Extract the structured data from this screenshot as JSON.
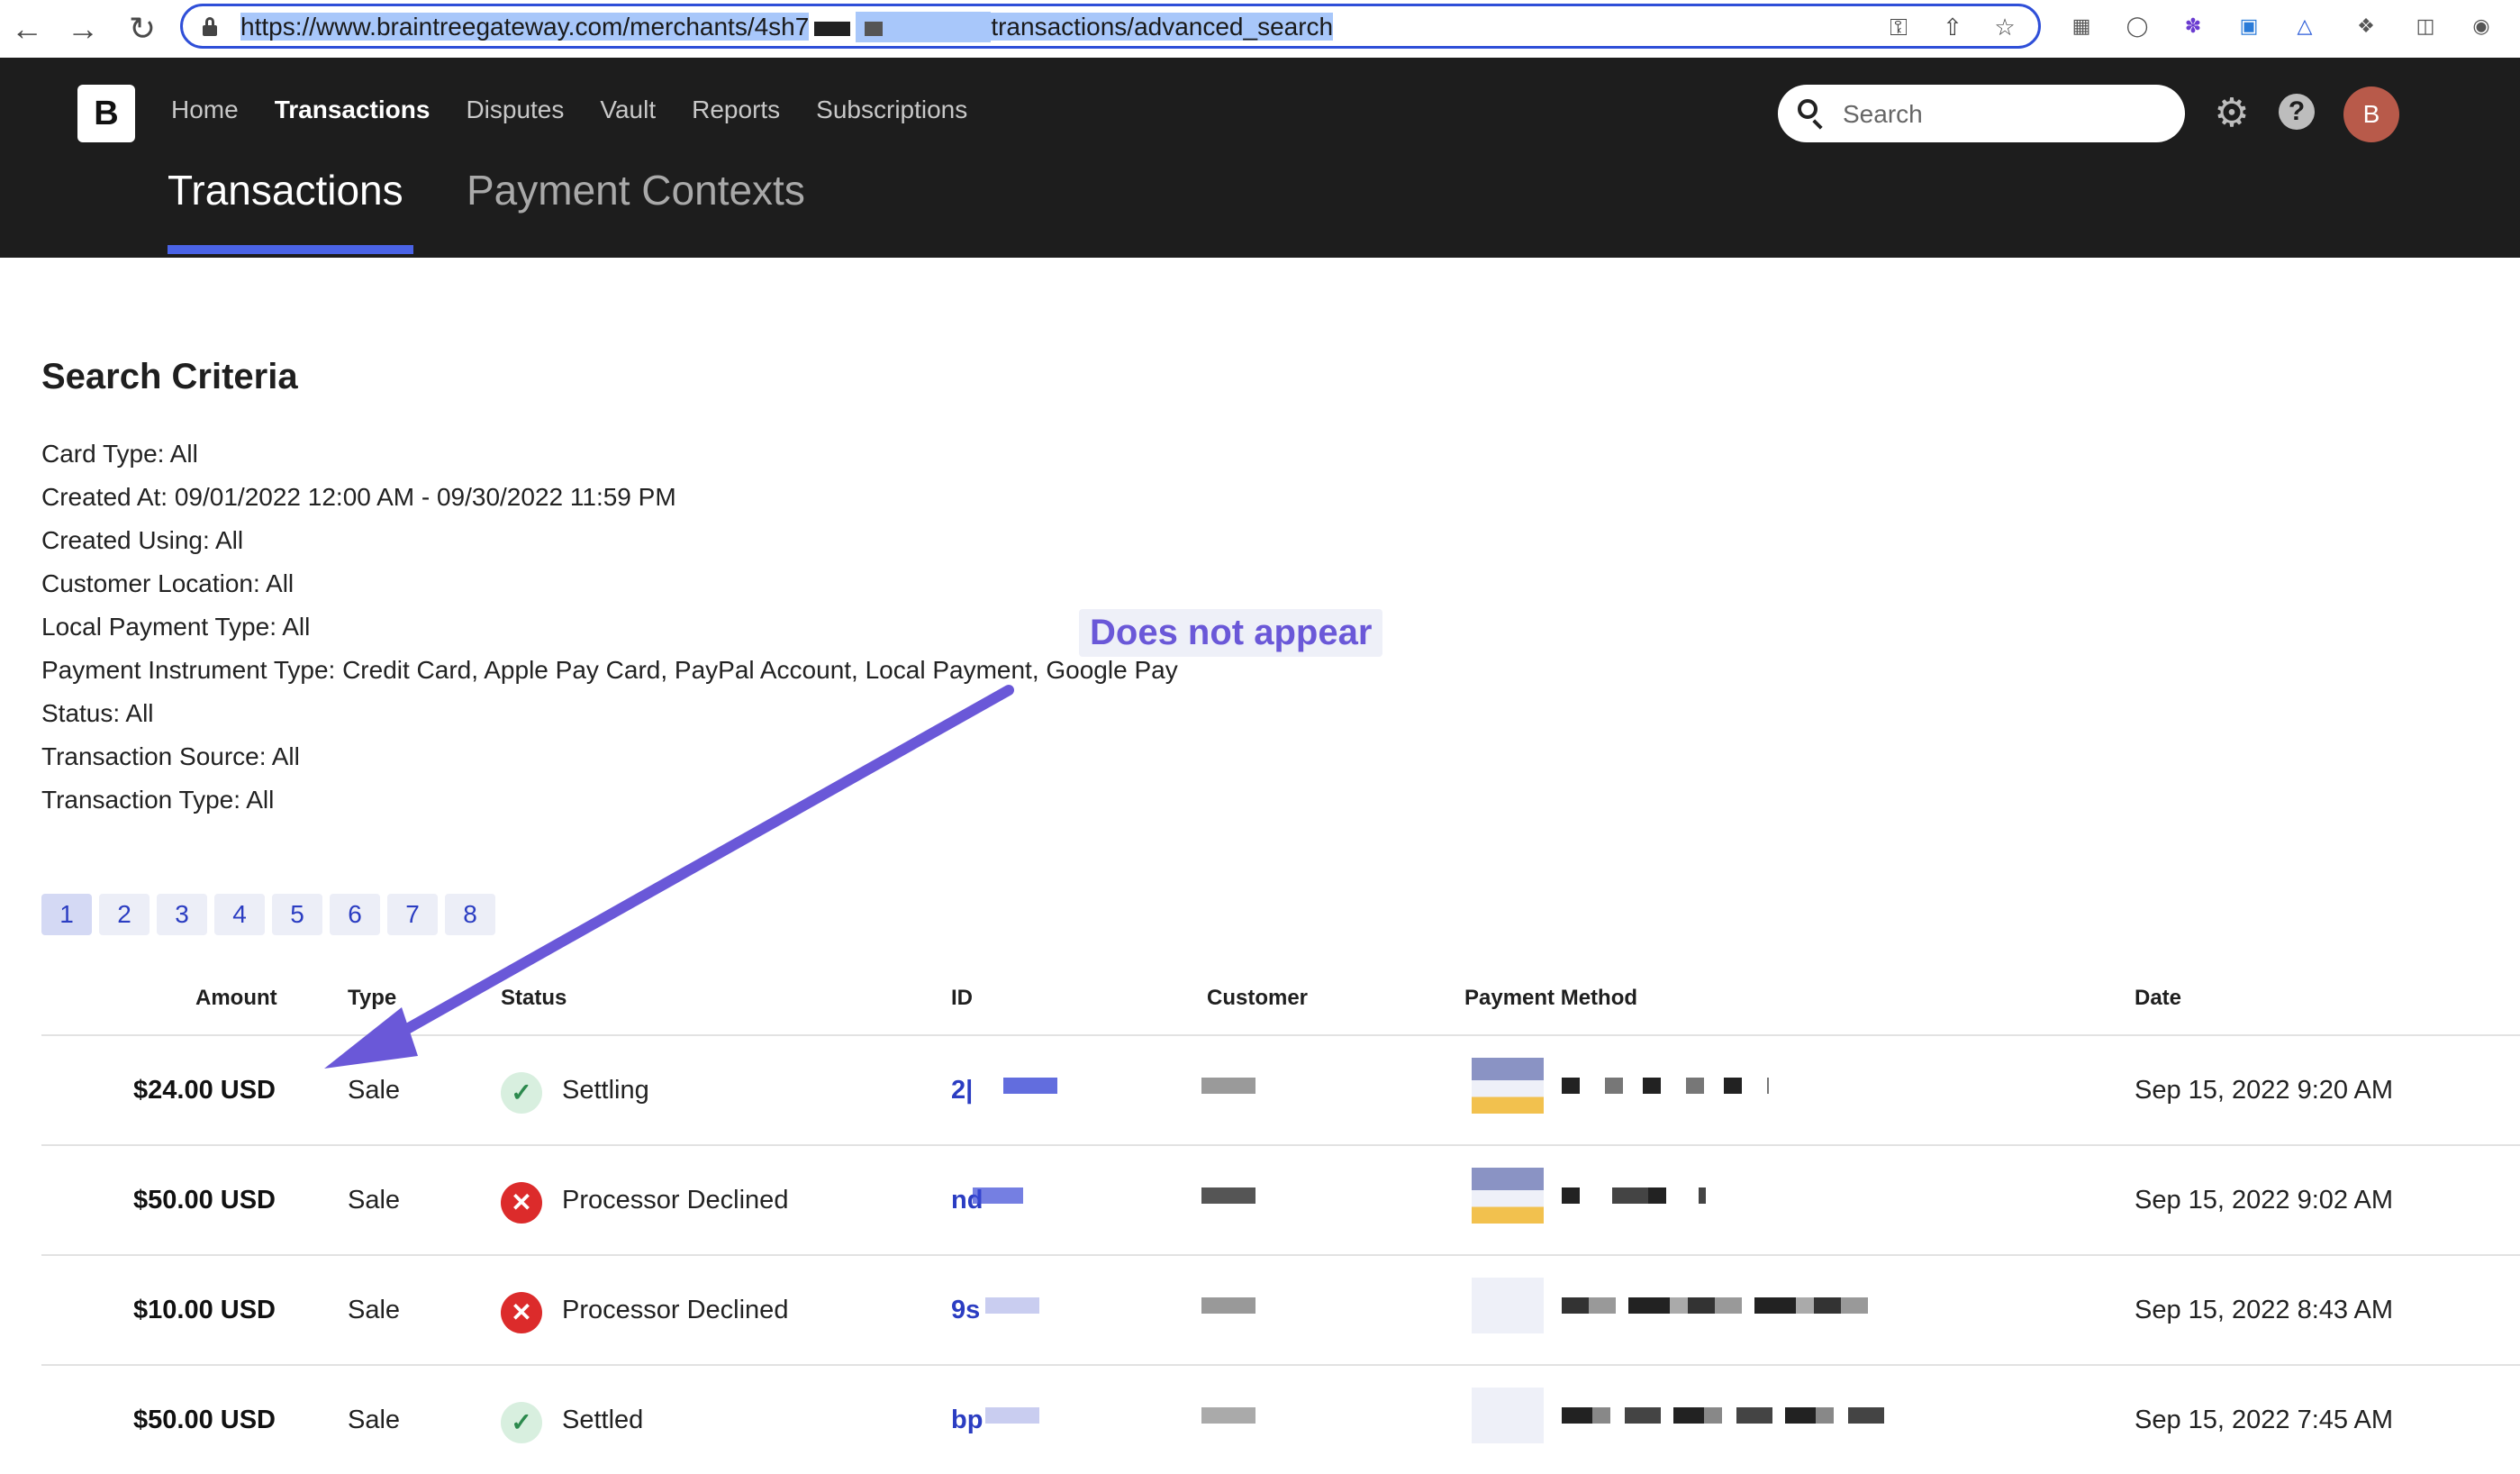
{
  "browser": {
    "url_prefix": "https://www.braintreegateway.com/merchants/4sh7",
    "url_suffix": "transactions/advanced_search"
  },
  "app": {
    "logo": "B",
    "nav": [
      "Home",
      "Transactions",
      "Disputes",
      "Vault",
      "Reports",
      "Subscriptions"
    ],
    "active_nav": "Transactions",
    "search_placeholder": "Search",
    "avatar_initial": "B",
    "subtabs": [
      "Transactions",
      "Payment Contexts"
    ]
  },
  "criteria": {
    "title": "Search Criteria",
    "lines": [
      "Card Type: All",
      "Created At: 09/01/2022 12:00 AM - 09/30/2022 11:59 PM",
      "Created Using: All",
      "Customer Location: All",
      "Local Payment Type: All",
      "Payment Instrument Type: Credit Card, Apple Pay Card, PayPal Account, Local Payment, Google Pay",
      "Status: All",
      "Transaction Source: All",
      "Transaction Type: All"
    ]
  },
  "pagination": [
    "1",
    "2",
    "3",
    "4",
    "5",
    "6",
    "7",
    "8"
  ],
  "table": {
    "headers": [
      "Amount",
      "Type",
      "Status",
      "ID",
      "Customer",
      "Payment Method",
      "Date"
    ],
    "rows": [
      {
        "amount": "$24.00 USD",
        "type": "Sale",
        "status": "Settling",
        "status_kind": "ok",
        "id": "2|",
        "date": "Sep 15, 2022 9:20 AM"
      },
      {
        "amount": "$50.00 USD",
        "type": "Sale",
        "status": "Processor Declined",
        "status_kind": "bad",
        "id": "nd",
        "date": "Sep 15, 2022 9:02 AM"
      },
      {
        "amount": "$10.00 USD",
        "type": "Sale",
        "status": "Processor Declined",
        "status_kind": "bad",
        "id": "9s",
        "date": "Sep 15, 2022 8:43 AM"
      },
      {
        "amount": "$50.00 USD",
        "type": "Sale",
        "status": "Settled",
        "status_kind": "ok",
        "id": "bp",
        "date": "Sep 15, 2022 7:45 AM"
      }
    ]
  },
  "annotation": {
    "text": "Does not appear",
    "color": "#6a58d8"
  },
  "colors": {
    "accent": "#4a63e6",
    "header_bg": "#1d1d1d",
    "link": "#2b3dc2"
  }
}
